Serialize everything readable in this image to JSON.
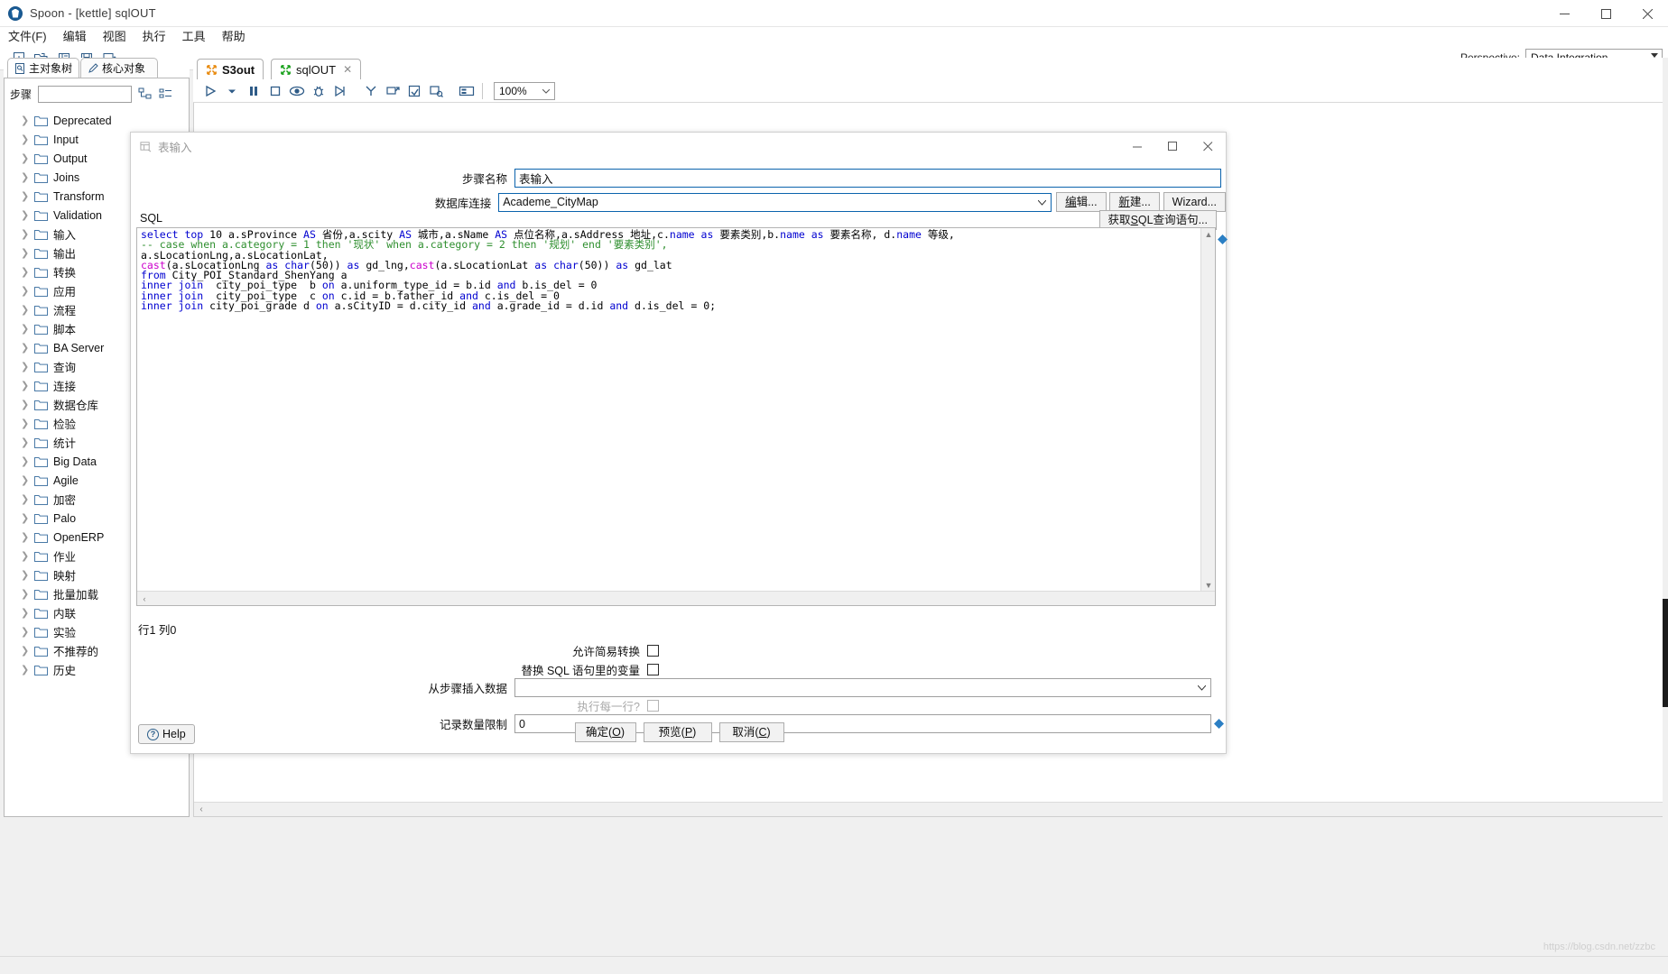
{
  "window": {
    "title": "Spoon - [kettle] sqlOUT",
    "app_icon": "spoon-icon",
    "minimize": "—",
    "maximize": "□",
    "close": "✕"
  },
  "menubar": {
    "items": [
      {
        "label": "文件(F)",
        "name": "menu-file"
      },
      {
        "label": "编辑",
        "name": "menu-edit"
      },
      {
        "label": "视图",
        "name": "menu-view"
      },
      {
        "label": "执行",
        "name": "menu-run"
      },
      {
        "label": "工具",
        "name": "menu-tools"
      },
      {
        "label": "帮助",
        "name": "menu-help"
      }
    ]
  },
  "toolbar": {
    "icons": [
      "new-file-icon",
      "open-folder-icon",
      "explorer-icon",
      "save-icon",
      "save-as-icon"
    ],
    "perspective_label": "Perspective:",
    "perspective_value": "Data Integration"
  },
  "left_panel": {
    "tabs": [
      {
        "label": "主对象树",
        "name": "tab-main-object-tree",
        "active": true,
        "icon": "document-icon"
      },
      {
        "label": "核心对象",
        "name": "tab-core-objects",
        "active": false,
        "icon": "pencil-icon"
      }
    ],
    "search": {
      "label": "步骤",
      "value": "",
      "placeholder": ""
    },
    "search_icons": [
      "expand-all-icon",
      "collapse-all-icon"
    ],
    "tree": [
      {
        "label": "Deprecated"
      },
      {
        "label": "Input"
      },
      {
        "label": "Output"
      },
      {
        "label": "Joins"
      },
      {
        "label": "Transform"
      },
      {
        "label": "Validation"
      },
      {
        "label": "输入"
      },
      {
        "label": "输出"
      },
      {
        "label": "转换"
      },
      {
        "label": "应用"
      },
      {
        "label": "流程"
      },
      {
        "label": "脚本"
      },
      {
        "label": "BA Server"
      },
      {
        "label": "查询"
      },
      {
        "label": "连接"
      },
      {
        "label": "数据仓库"
      },
      {
        "label": "检验"
      },
      {
        "label": "统计"
      },
      {
        "label": "Big Data"
      },
      {
        "label": "Agile"
      },
      {
        "label": "加密"
      },
      {
        "label": "Palo"
      },
      {
        "label": "OpenERP"
      },
      {
        "label": "作业"
      },
      {
        "label": "映射"
      },
      {
        "label": "批量加载"
      },
      {
        "label": "内联"
      },
      {
        "label": "实验"
      },
      {
        "label": "不推荐的"
      },
      {
        "label": "历史"
      }
    ]
  },
  "editor": {
    "tabs": [
      {
        "label": "S3out",
        "name": "tab-s3out",
        "active": false,
        "icon": "transformation-icon",
        "closable": false
      },
      {
        "label": "sqlOUT",
        "name": "tab-sqlout",
        "active": true,
        "icon": "transformation-icon",
        "closable": true,
        "close": "✕"
      }
    ],
    "toolbar_icons": [
      "run-icon",
      "run-dropdown-icon",
      "pause-icon",
      "stop-icon",
      "preview-icon",
      "debug-icon",
      "replay-icon",
      "align-icon",
      "grid-snap-icon",
      "impact-icon",
      "sql-check-icon",
      "results-panel-icon"
    ],
    "zoom_value": "100%"
  },
  "dialog": {
    "title": "表输入",
    "title_icon": "table-input-icon",
    "minimize": "—",
    "maximize": "□",
    "close": "✕",
    "fields": {
      "step_name_label": "步骤名称",
      "step_name_value": "表输入",
      "connection_label": "数据库连接",
      "connection_value": "Academe_CityMap",
      "edit_button": "编辑...",
      "new_button": "新建...",
      "wizard_button": "Wizard...",
      "get_sql_button": "获取SQL查询语句...",
      "sql_label": "SQL",
      "row_col_status": "行1 列0",
      "allow_simple_transform_label": "允许简易转换",
      "replace_vars_label": "替换 SQL 语句里的变量",
      "insert_from_step_label": "从步骤插入数据",
      "insert_from_step_value": "",
      "execute_each_row_label": "执行每一行?",
      "limit_label": "记录数量限制",
      "limit_value": "0"
    },
    "sql_lines": [
      [
        {
          "t": "select top ",
          "c": "kw"
        },
        {
          "t": "10 a.sProvince ",
          "c": ""
        },
        {
          "t": "AS",
          "c": "kw"
        },
        {
          "t": " 省份,a.scity ",
          "c": ""
        },
        {
          "t": "AS",
          "c": "kw"
        },
        {
          "t": " 城市,a.sName ",
          "c": ""
        },
        {
          "t": "AS",
          "c": "kw"
        },
        {
          "t": " 点位名称,a.sAddress ",
          "c": ""
        },
        {
          "t": "地址,c.",
          "c": ""
        },
        {
          "t": "name",
          "c": "kw"
        },
        {
          "t": " ",
          "c": ""
        },
        {
          "t": "as",
          "c": "kw"
        },
        {
          "t": " 要素类别,b.",
          "c": ""
        },
        {
          "t": "name",
          "c": "kw"
        },
        {
          "t": " ",
          "c": ""
        },
        {
          "t": "as",
          "c": "kw"
        },
        {
          "t": " 要素名称, d.",
          "c": ""
        },
        {
          "t": "name",
          "c": "kw"
        },
        {
          "t": " 等级,",
          "c": ""
        }
      ],
      [
        {
          "t": "-- case when a.category = 1 then '现状' when a.category = 2 then '规划' end '要素类别',",
          "c": "cmt"
        }
      ],
      [
        {
          "t": "a.sLocationLng,a.sLocationLat,",
          "c": ""
        }
      ],
      [
        {
          "t": "cast",
          "c": "fn"
        },
        {
          "t": "(a.sLocationLng ",
          "c": ""
        },
        {
          "t": "as",
          "c": "kw"
        },
        {
          "t": " ",
          "c": ""
        },
        {
          "t": "char",
          "c": "kw"
        },
        {
          "t": "(50)) ",
          "c": ""
        },
        {
          "t": "as",
          "c": "kw"
        },
        {
          "t": " gd_lng,",
          "c": ""
        },
        {
          "t": "cast",
          "c": "fn"
        },
        {
          "t": "(a.sLocationLat ",
          "c": ""
        },
        {
          "t": "as",
          "c": "kw"
        },
        {
          "t": " ",
          "c": ""
        },
        {
          "t": "char",
          "c": "kw"
        },
        {
          "t": "(50)) ",
          "c": ""
        },
        {
          "t": "as",
          "c": "kw"
        },
        {
          "t": " gd_lat",
          "c": ""
        }
      ],
      [
        {
          "t": "from",
          "c": "kw"
        },
        {
          "t": " City_POI_Standard_ShenYang a",
          "c": ""
        }
      ],
      [
        {
          "t": "inner join",
          "c": "kw"
        },
        {
          "t": "  city_poi_type  b ",
          "c": ""
        },
        {
          "t": "on",
          "c": "kw"
        },
        {
          "t": " a.uniform_type_id = b.id ",
          "c": ""
        },
        {
          "t": "and",
          "c": "kw"
        },
        {
          "t": " b.is_del = 0",
          "c": ""
        }
      ],
      [
        {
          "t": "inner join",
          "c": "kw"
        },
        {
          "t": "  city_poi_type  c ",
          "c": ""
        },
        {
          "t": "on",
          "c": "kw"
        },
        {
          "t": " c.id = b.father_id ",
          "c": ""
        },
        {
          "t": "and",
          "c": "kw"
        },
        {
          "t": " c.is_del = 0",
          "c": ""
        }
      ],
      [
        {
          "t": "inner join",
          "c": "kw"
        },
        {
          "t": " city_poi_grade d ",
          "c": ""
        },
        {
          "t": "on",
          "c": "kw"
        },
        {
          "t": " a.sCityID = d.city_id ",
          "c": ""
        },
        {
          "t": "and",
          "c": "kw"
        },
        {
          "t": " a.grade_id = d.id ",
          "c": ""
        },
        {
          "t": "and",
          "c": "kw"
        },
        {
          "t": " d.is_del = 0;",
          "c": ""
        }
      ]
    ],
    "buttons": {
      "ok": "确定(O)",
      "preview": "预览(P)",
      "cancel": "取消(C)",
      "help": "Help"
    }
  },
  "colors": {
    "accent": "#0b63ad",
    "keyword": "#0000d0",
    "comment": "#2f8f2f",
    "function": "#cc00cc",
    "icon": "#2e5b87"
  },
  "watermark": "https://blog.csdn.net/zzbc"
}
